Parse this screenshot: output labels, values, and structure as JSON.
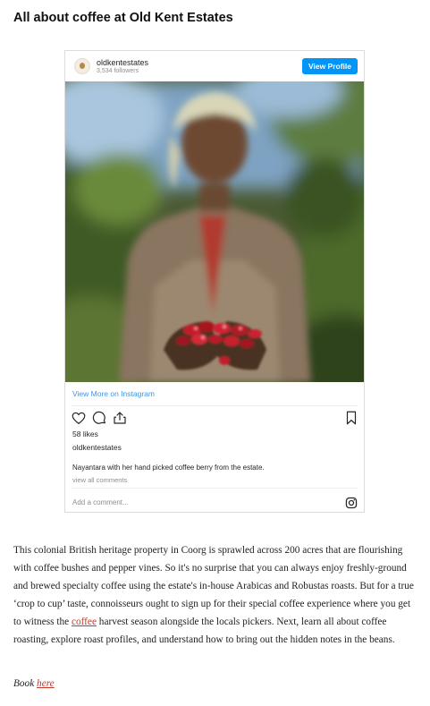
{
  "page": {
    "title": "All about coffee at Old Kent Estates"
  },
  "instagram": {
    "username": "oldkentestates",
    "followers": "3,534 followers",
    "view_profile_label": "View Profile",
    "view_more_label": "View More on Instagram",
    "likes": "58 likes",
    "owner": "oldkentestates",
    "caption": "Nayantara with her hand picked coffee berry from the estate.",
    "view_all_comments": "view all comments",
    "add_comment_placeholder": "Add a comment...",
    "icons": [
      "heart-icon",
      "comment-icon",
      "share-icon",
      "bookmark-icon",
      "instagram-logo-icon"
    ],
    "colors": {
      "button": "#0095f6",
      "link": "#3897f0"
    }
  },
  "article": {
    "p1_a": "This colonial British heritage property in Coorg is sprawled across 200 acres that are flourishing with coffee bushes and pepper vines. So it's no surprise that you can always enjoy freshly-ground and brewed specialty coffee using the estate's in-house Arabicas and Robustas roasts. But for a true ‘crop to cup’ taste, connoisseurs ought to sign up for their special coffee experience where you get to witness the ",
    "p1_link": "coffee",
    "p1_b": " harvest season alongside the locals pickers. Next, learn all about coffee roasting, explore roast profiles, and understand how to bring out the hidden notes in the beans.",
    "book_prefix": "Book ",
    "book_link": "here",
    "link_color": "#c0392b"
  }
}
